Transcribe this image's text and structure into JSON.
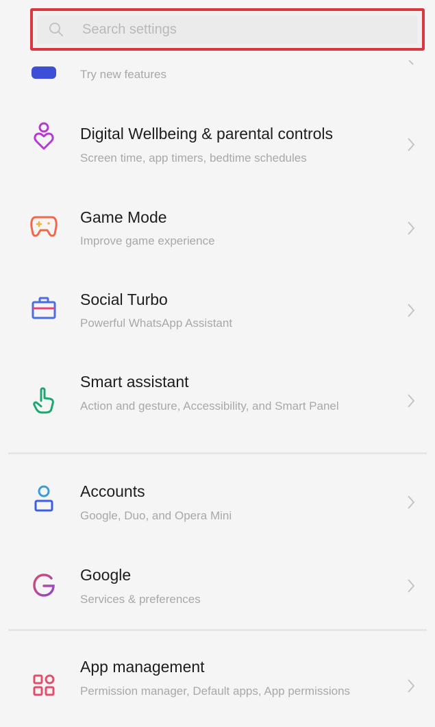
{
  "search": {
    "placeholder": "Search settings"
  },
  "items": [
    {
      "title": "",
      "subtitle": "Try new features",
      "icon": "labs-icon",
      "color": "#3d4fd6"
    },
    {
      "title": "Digital Wellbeing & parental controls",
      "subtitle": "Screen time, app timers, bedtime schedules",
      "icon": "wellbeing-icon",
      "color": "#b43ad0"
    },
    {
      "title": "Game Mode",
      "subtitle": "Improve game experience",
      "icon": "gamepad-icon",
      "color": "#f0674b"
    },
    {
      "title": "Social Turbo",
      "subtitle": "Powerful WhatsApp Assistant",
      "icon": "briefcase-icon",
      "color": "#4a6de0"
    },
    {
      "title": "Smart assistant",
      "subtitle": "Action and gesture, Accessibility, and Smart Panel",
      "icon": "hand-pointer-icon",
      "color": "#1ea672"
    },
    {
      "title": "Accounts",
      "subtitle": "Google, Duo, and Opera Mini",
      "icon": "account-icon",
      "color": "#3a7fe0"
    },
    {
      "title": "Google",
      "subtitle": "Services & preferences",
      "icon": "google-icon",
      "color": "#d94a6e"
    },
    {
      "title": "App management",
      "subtitle": "Permission manager, Default apps, App permissions",
      "icon": "app-grid-icon",
      "color": "#e0506e"
    }
  ],
  "colors": {
    "highlight": "#d9363e",
    "title": "#1d1d1d",
    "subtitle": "#a8a8a8",
    "chevron": "#c4c4c4"
  }
}
